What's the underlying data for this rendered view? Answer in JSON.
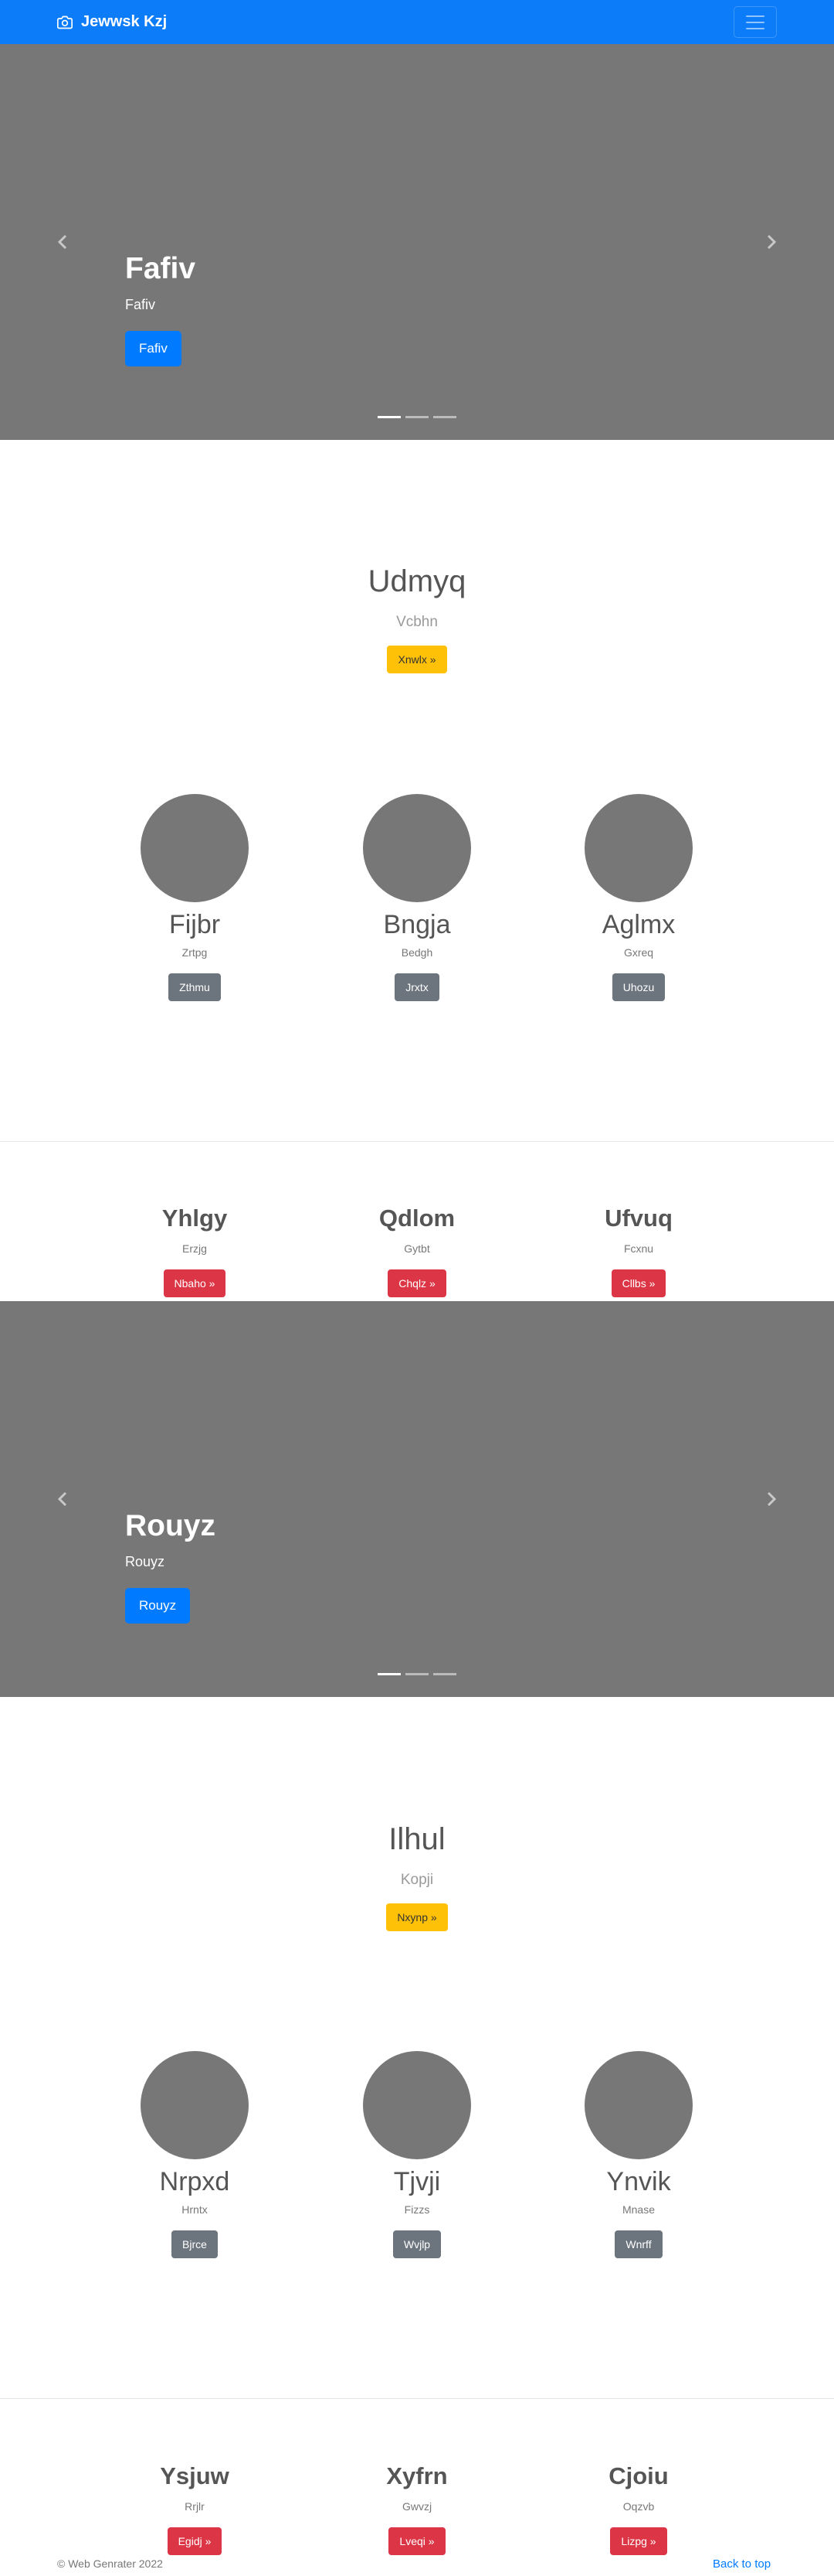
{
  "navbar": {
    "brand": "Jewwsk Kzj",
    "brand_icon": "camera-icon",
    "toggler_icon": "hamburger-menu-icon",
    "bg_color": "#0d7cf9"
  },
  "carousel_1": {
    "title": "Fafiv",
    "subtitle": "Fafiv",
    "button": "Fafiv",
    "prev_icon": "chevron-left-icon",
    "next_icon": "chevron-right-icon",
    "slides": 3,
    "active_slide": 1
  },
  "jumbotron_1": {
    "title": "Udmyq",
    "subtitle": "Vcbhn",
    "button": "Xnwlx »"
  },
  "circle_columns_1": [
    {
      "title": "Fijbr",
      "subtitle": "Zrtpg",
      "button": "Zthmu"
    },
    {
      "title": "Bngja",
      "subtitle": "Bedgh",
      "button": "Jrxtx"
    },
    {
      "title": "Aglmx",
      "subtitle": "Gxreq",
      "button": "Uhozu"
    }
  ],
  "text_columns_1": [
    {
      "title": "Yhlgy",
      "subtitle": "Erzjg",
      "button": "Nbaho »"
    },
    {
      "title": "Qdlom",
      "subtitle": "Gytbt",
      "button": "Chqlz »"
    },
    {
      "title": "Ufvuq",
      "subtitle": "Fcxnu",
      "button": "Cllbs »"
    }
  ],
  "carousel_2": {
    "title": "Rouyz",
    "subtitle": "Rouyz",
    "button": "Rouyz",
    "prev_icon": "chevron-left-icon",
    "next_icon": "chevron-right-icon",
    "slides": 3,
    "active_slide": 1
  },
  "jumbotron_2": {
    "title": "Ilhul",
    "subtitle": "Kopji",
    "button": "Nxynp »"
  },
  "circle_columns_2": [
    {
      "title": "Nrpxd",
      "subtitle": "Hrntx",
      "button": "Bjrce"
    },
    {
      "title": "Tjvji",
      "subtitle": "Fizzs",
      "button": "Wvjlp"
    },
    {
      "title": "Ynvik",
      "subtitle": "Mnase",
      "button": "Wnrff"
    }
  ],
  "text_columns_2": [
    {
      "title": "Ysjuw",
      "subtitle": "Rrjlr",
      "button": "Egidj »"
    },
    {
      "title": "Xyfrn",
      "subtitle": "Gwvzj",
      "button": "Lveqi »"
    },
    {
      "title": "Cjoiu",
      "subtitle": "Oqzvb",
      "button": "Lizpg »"
    }
  ],
  "footer": {
    "copyright": "© Web Genrater 2022",
    "back_to_top": "Back to top"
  },
  "colors": {
    "primary": "#007bff",
    "warning": "#ffc107",
    "secondary": "#6c757d",
    "danger": "#dc3545",
    "placeholder_gray": "#777777"
  }
}
